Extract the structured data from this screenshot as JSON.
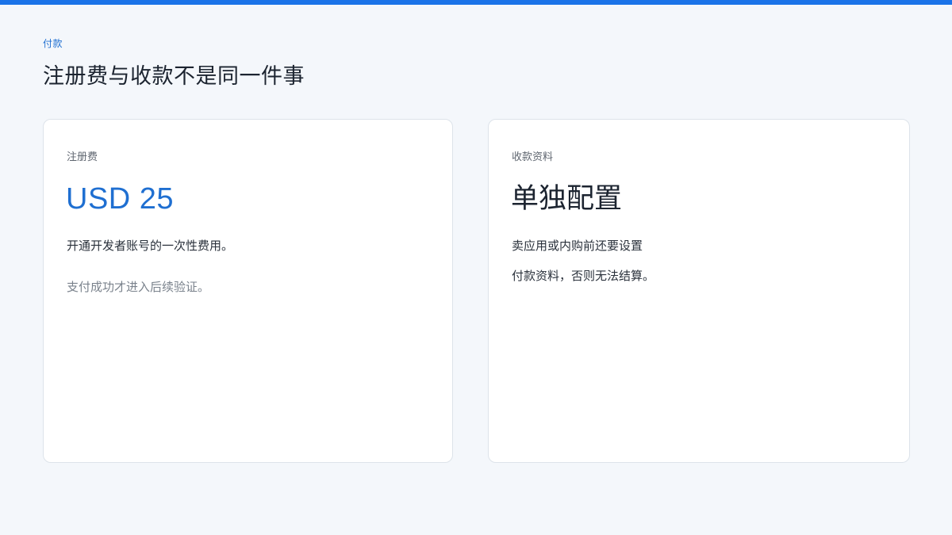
{
  "header": {
    "eyebrow": "付款",
    "title": "注册费与收款不是同一件事"
  },
  "cards": {
    "registration": {
      "label": "注册费",
      "value": "USD 25",
      "lines": [
        "开通开发者账号的一次性费用。",
        "支付成功才进入后续验证。"
      ]
    },
    "payout": {
      "label": "收款资料",
      "value": "单独配置",
      "lines": [
        "卖应用或内购前还要设置",
        "付款资料，否则无法结算。"
      ]
    }
  },
  "colors": {
    "accent": "#1a73e8",
    "value_blue": "#1f6fd1",
    "background": "#f4f7fb",
    "card": "#ffffff"
  }
}
